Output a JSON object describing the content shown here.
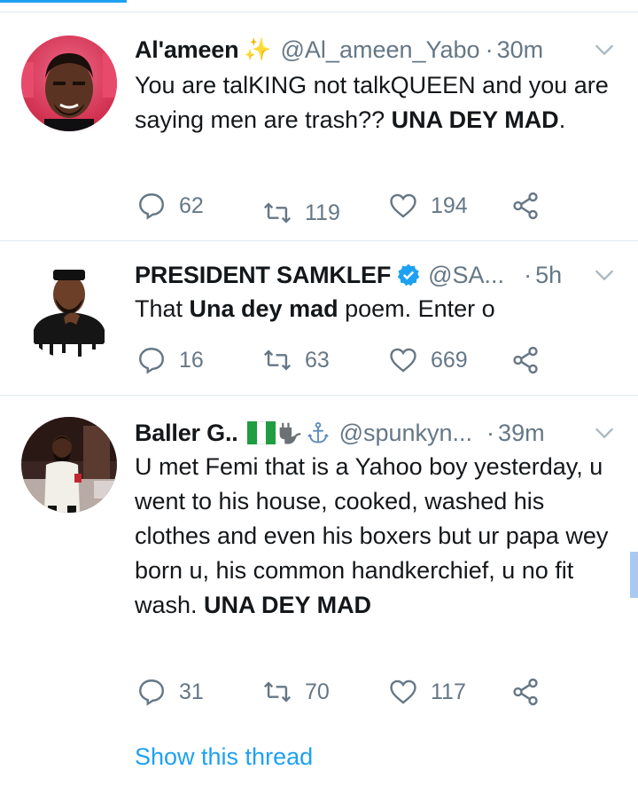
{
  "tweets": [
    {
      "name": "Al'ameen",
      "name_emoji": "✨",
      "handle": "@Al_ameen_Yabo",
      "time": "30m",
      "text_parts": [
        "You are talKING not talkQUEEN and you are saying men are trash?? ",
        "UNA DEY MAD",
        "."
      ],
      "replies": "62",
      "retweets": "119",
      "likes": "194"
    },
    {
      "name": "PRESIDENT SAMKLEF",
      "verified": true,
      "handle": "@SA...",
      "time": "5h",
      "text_parts": [
        "That ",
        "Una dey mad",
        " poem. Enter o"
      ],
      "replies": "16",
      "retweets": "63",
      "likes": "669"
    },
    {
      "name": "Baller G..",
      "name_emoji": "🇳🇬🔌⚓",
      "handle": "@spunkyn...",
      "time": "39m",
      "text_parts": [
        "U met Femi that is a Yahoo boy yesterday, u went to his house, cooked, washed his clothes and even his boxers but ur papa wey born u, his common handkerchief, u no fit wash. ",
        "UNA DEY MAD"
      ],
      "replies": "31",
      "retweets": "70",
      "likes": "117"
    }
  ],
  "show_thread_label": "Show this thread",
  "colors": {
    "link": "#1da1f2",
    "secondary": "#657786",
    "divider": "#e1e8ed"
  }
}
